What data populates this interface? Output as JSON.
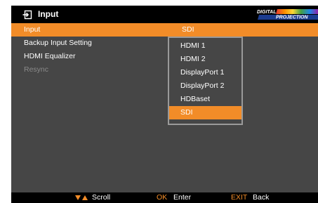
{
  "header": {
    "title": "Input",
    "logo_line1": "DIGITAL",
    "logo_line2": "PROJECTION"
  },
  "menu": {
    "rows": [
      {
        "label": "Input",
        "value": "SDI"
      },
      {
        "label": "Backup Input Setting"
      },
      {
        "label": "HDMI Equalizer"
      },
      {
        "label": "Resync"
      }
    ]
  },
  "dropdown": {
    "options": [
      "HDMI 1",
      "HDMI 2",
      "DisplayPort 1",
      "DisplayPort 2",
      "HDBaset",
      "SDI"
    ],
    "selected_index": 5
  },
  "footer": {
    "scroll_label": "Scroll",
    "ok_key": "OK",
    "ok_label": "Enter",
    "exit_key": "EXIT",
    "exit_label": "Back"
  },
  "colors": {
    "accent": "#f28c28",
    "background": "#464646",
    "bar": "#000000",
    "disabled": "#8a8a8a"
  },
  "icons": {
    "title": "input-icon",
    "scroll": "scroll-arrows-icon"
  }
}
